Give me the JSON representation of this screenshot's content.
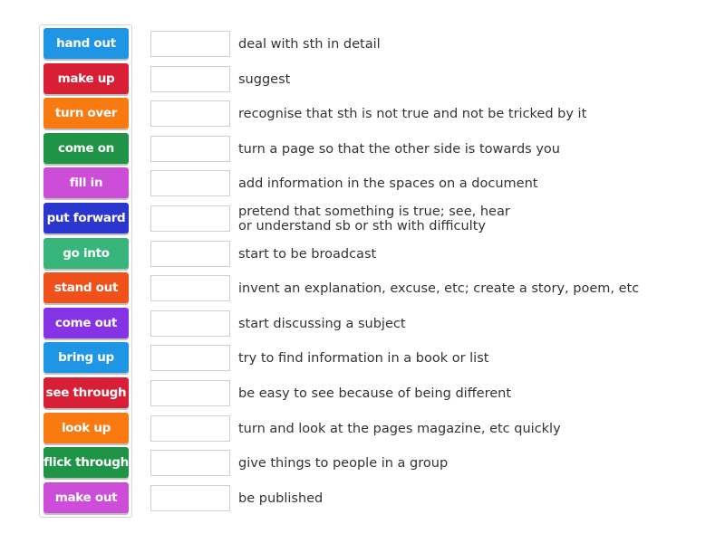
{
  "tiles": [
    {
      "label": "hand out",
      "color": "#1f95e6"
    },
    {
      "label": "make up",
      "color": "#d81f36"
    },
    {
      "label": "turn over",
      "color": "#f97a10"
    },
    {
      "label": "come on",
      "color": "#1f9447"
    },
    {
      "label": "fill in",
      "color": "#cc4ed8"
    },
    {
      "label": "put forward",
      "color": "#2b36cf"
    },
    {
      "label": "go into",
      "color": "#37b57a"
    },
    {
      "label": "stand out",
      "color": "#f0501a"
    },
    {
      "label": "come out",
      "color": "#8633e6"
    },
    {
      "label": "bring up",
      "color": "#1f95e6"
    },
    {
      "label": "see through",
      "color": "#d81f36"
    },
    {
      "label": "look up",
      "color": "#f97a10"
    },
    {
      "label": "flick through",
      "color": "#1f9447"
    },
    {
      "label": "make out",
      "color": "#cc4ed8"
    }
  ],
  "definitions": [
    "deal with sth in detail",
    "suggest",
    "recognise that sth is not true and not be tricked by it",
    "turn a page so that the other side is towards you",
    "add information in the spaces on a document",
    "pretend that something is true; see, hear\nor understand sb or sth with difficulty",
    "start to be broadcast",
    "invent an explanation, excuse, etc; create a story, poem, etc",
    "start discussing a subject",
    "try to find information in a book or list",
    "be easy to see because of being different",
    "turn and look at the pages magazine, etc quickly",
    "give things to people in a group",
    "be published"
  ]
}
